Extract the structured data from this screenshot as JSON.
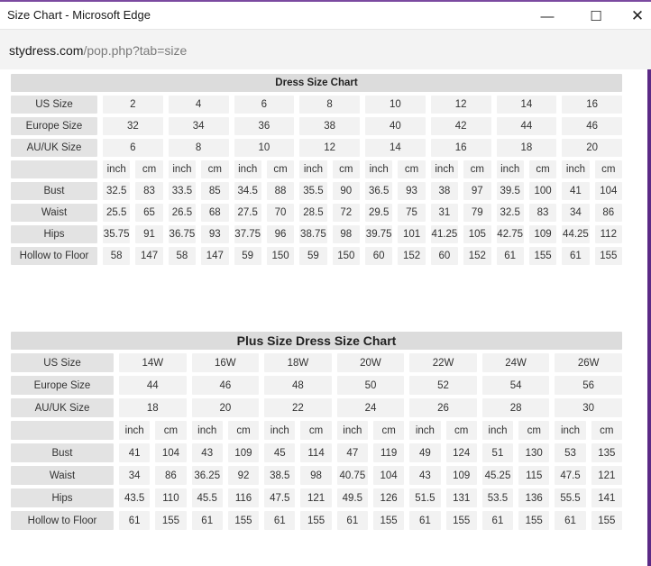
{
  "window": {
    "title": "Size Chart - Microsoft Edge",
    "minimize_glyph": "—",
    "maximize_glyph": "☐",
    "close_glyph": "✕"
  },
  "address": {
    "domain": "stydress.com",
    "path": "/pop.php?tab=size"
  },
  "dress_chart": {
    "title": "Dress Size Chart",
    "label_header": [
      "US Size",
      "Europe Size",
      "AU/UK Size"
    ],
    "us": [
      "2",
      "4",
      "6",
      "8",
      "10",
      "12",
      "14",
      "16"
    ],
    "eu": [
      "32",
      "34",
      "36",
      "38",
      "40",
      "42",
      "44",
      "46"
    ],
    "au": [
      "6",
      "8",
      "10",
      "12",
      "14",
      "16",
      "18",
      "20"
    ],
    "unit_inch": "inch",
    "unit_cm": "cm",
    "rows": [
      {
        "label": "Bust",
        "vals": [
          "32.5",
          "83",
          "33.5",
          "85",
          "34.5",
          "88",
          "35.5",
          "90",
          "36.5",
          "93",
          "38",
          "97",
          "39.5",
          "100",
          "41",
          "104"
        ]
      },
      {
        "label": "Waist",
        "vals": [
          "25.5",
          "65",
          "26.5",
          "68",
          "27.5",
          "70",
          "28.5",
          "72",
          "29.5",
          "75",
          "31",
          "79",
          "32.5",
          "83",
          "34",
          "86"
        ]
      },
      {
        "label": "Hips",
        "vals": [
          "35.75",
          "91",
          "36.75",
          "93",
          "37.75",
          "96",
          "38.75",
          "98",
          "39.75",
          "101",
          "41.25",
          "105",
          "42.75",
          "109",
          "44.25",
          "112"
        ]
      },
      {
        "label": "Hollow to Floor",
        "vals": [
          "58",
          "147",
          "58",
          "147",
          "59",
          "150",
          "59",
          "150",
          "60",
          "152",
          "60",
          "152",
          "61",
          "155",
          "61",
          "155"
        ]
      }
    ]
  },
  "plus_chart": {
    "title": "Plus Size Dress Size Chart",
    "label_header": [
      "US Size",
      "Europe Size",
      "AU/UK Size"
    ],
    "us": [
      "14W",
      "16W",
      "18W",
      "20W",
      "22W",
      "24W",
      "26W"
    ],
    "eu": [
      "44",
      "46",
      "48",
      "50",
      "52",
      "54",
      "56"
    ],
    "au": [
      "18",
      "20",
      "22",
      "24",
      "26",
      "28",
      "30"
    ],
    "unit_inch": "inch",
    "unit_cm": "cm",
    "rows": [
      {
        "label": "Bust",
        "vals": [
          "41",
          "104",
          "43",
          "109",
          "45",
          "114",
          "47",
          "119",
          "49",
          "124",
          "51",
          "130",
          "53",
          "135"
        ]
      },
      {
        "label": "Waist",
        "vals": [
          "34",
          "86",
          "36.25",
          "92",
          "38.5",
          "98",
          "40.75",
          "104",
          "43",
          "109",
          "45.25",
          "115",
          "47.5",
          "121"
        ]
      },
      {
        "label": "Hips",
        "vals": [
          "43.5",
          "110",
          "45.5",
          "116",
          "47.5",
          "121",
          "49.5",
          "126",
          "51.5",
          "131",
          "53.5",
          "136",
          "55.5",
          "141"
        ]
      },
      {
        "label": "Hollow to Floor",
        "vals": [
          "61",
          "155",
          "61",
          "155",
          "61",
          "155",
          "61",
          "155",
          "61",
          "155",
          "61",
          "155",
          "61",
          "155"
        ]
      }
    ]
  }
}
